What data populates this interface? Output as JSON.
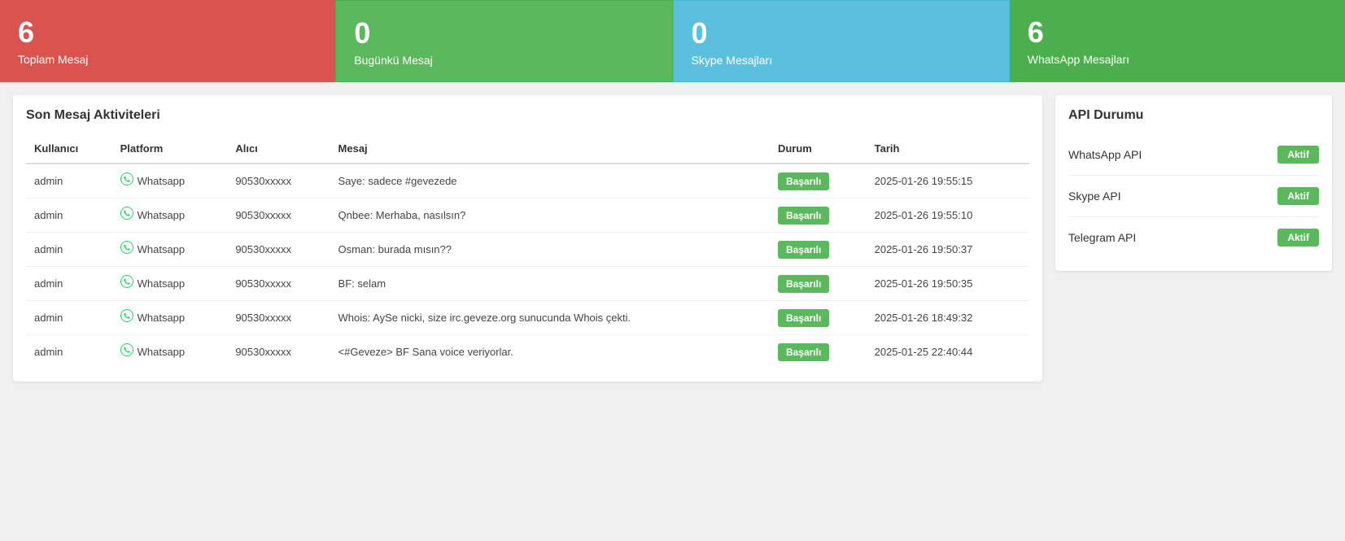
{
  "stats": [
    {
      "id": "toplam",
      "number": "6",
      "label": "Toplam Mesaj",
      "color": "red"
    },
    {
      "id": "bugun",
      "number": "0",
      "label": "Bugünkü Mesaj",
      "color": "green"
    },
    {
      "id": "skype",
      "number": "0",
      "label": "Skype Mesajları",
      "color": "teal"
    },
    {
      "id": "whatsapp",
      "number": "6",
      "label": "WhatsApp Mesajları",
      "color": "darkgreen"
    }
  ],
  "messages_section": {
    "title": "Son Mesaj Aktiviteleri"
  },
  "table": {
    "headers": [
      "Kullanıcı",
      "Platform",
      "Alıcı",
      "Mesaj",
      "Durum",
      "Tarih"
    ],
    "rows": [
      {
        "kullanici": "admin",
        "platform": "Whatsapp",
        "alici": "90530xxxxx",
        "mesaj": "Saye: sadece #gevezede",
        "durum": "Başarılı",
        "tarih": "2025-01-26 19:55:15"
      },
      {
        "kullanici": "admin",
        "platform": "Whatsapp",
        "alici": "90530xxxxx",
        "mesaj": "Qnbee: Merhaba, nasılsın?",
        "durum": "Başarılı",
        "tarih": "2025-01-26 19:55:10"
      },
      {
        "kullanici": "admin",
        "platform": "Whatsapp",
        "alici": "90530xxxxx",
        "mesaj": "Osman: burada mısın??",
        "durum": "Başarılı",
        "tarih": "2025-01-26 19:50:37"
      },
      {
        "kullanici": "admin",
        "platform": "Whatsapp",
        "alici": "90530xxxxx",
        "mesaj": "BF: selam",
        "durum": "Başarılı",
        "tarih": "2025-01-26 19:50:35"
      },
      {
        "kullanici": "admin",
        "platform": "Whatsapp",
        "alici": "90530xxxxx",
        "mesaj": "Whois: AySe nicki, size irc.geveze.org sunucunda Whois çekti.",
        "durum": "Başarılı",
        "tarih": "2025-01-26 18:49:32"
      },
      {
        "kullanici": "admin",
        "platform": "Whatsapp",
        "alici": "90530xxxxx",
        "mesaj": "<#Geveze> BF Sana voice veriyorlar.",
        "durum": "Başarılı",
        "tarih": "2025-01-25 22:40:44"
      }
    ]
  },
  "api_section": {
    "title": "API Durumu",
    "apis": [
      {
        "name": "WhatsApp API",
        "status": "Aktif"
      },
      {
        "name": "Skype API",
        "status": "Aktif"
      },
      {
        "name": "Telegram API",
        "status": "Aktif"
      }
    ]
  },
  "labels": {
    "basarili": "Başarılı",
    "aktif": "Aktif"
  }
}
